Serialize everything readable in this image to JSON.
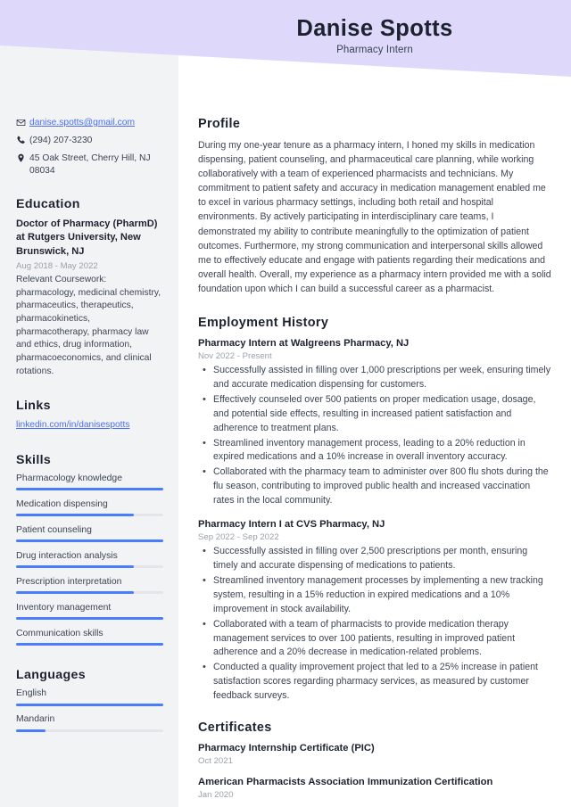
{
  "header": {
    "name": "Danise Spotts",
    "job_title": "Pharmacy Intern",
    "band_color": "#ded9fb"
  },
  "sidebar": {
    "background_color": "#f2f3f5",
    "contact": [
      {
        "icon": "envelope-icon",
        "value": "danise.spotts@gmail.com",
        "is_link": true
      },
      {
        "icon": "phone-icon",
        "value": "(294) 207-3230",
        "is_link": false
      },
      {
        "icon": "location-pin-icon",
        "value": "45 Oak Street, Cherry Hill, NJ 08034",
        "is_link": false
      }
    ],
    "education": {
      "heading": "Education",
      "degree": "Doctor of Pharmacy (PharmD) at Rutgers University, New Brunswick, NJ",
      "date": "Aug 2018 - May 2022",
      "description": "Relevant Coursework: pharmacology, medicinal chemistry, pharmaceutics, therapeutics, pharmacokinetics, pharmacotherapy, pharmacy law and ethics, drug information, pharmacoeconomics, and clinical rotations."
    },
    "links": {
      "heading": "Links",
      "items": [
        {
          "label": "linkedin.com/in/danisespotts"
        }
      ]
    },
    "skills": {
      "heading": "Skills",
      "accent_color": "#4a7dfc",
      "track_color": "#e3e5e9",
      "items": [
        {
          "label": "Pharmacology knowledge",
          "level": 100
        },
        {
          "label": "Medication dispensing",
          "level": 80
        },
        {
          "label": "Patient counseling",
          "level": 100
        },
        {
          "label": "Drug interaction analysis",
          "level": 80
        },
        {
          "label": "Prescription interpretation",
          "level": 80
        },
        {
          "label": "Inventory management",
          "level": 100
        },
        {
          "label": "Communication skills",
          "level": 100
        }
      ]
    },
    "languages": {
      "heading": "Languages",
      "items": [
        {
          "label": "English",
          "level": 100
        },
        {
          "label": "Mandarin",
          "level": 20
        }
      ]
    }
  },
  "main": {
    "profile": {
      "heading": "Profile",
      "text": "During my one-year tenure as a pharmacy intern, I honed my skills in medication dispensing, patient counseling, and pharmaceutical care planning, while working collaboratively with a team of experienced pharmacists and technicians. My commitment to patient safety and accuracy in medication management enabled me to excel in various pharmacy settings, including both retail and hospital environments. By actively participating in interdisciplinary care teams, I demonstrated my ability to contribute meaningfully to the optimization of patient outcomes. Furthermore, my strong communication and interpersonal skills allowed me to effectively educate and engage with patients regarding their medications and overall health. Overall, my experience as a pharmacy intern provided me with a solid foundation upon which I can build a successful career as a pharmacist."
    },
    "employment": {
      "heading": "Employment History",
      "jobs": [
        {
          "title": "Pharmacy Intern at Walgreens Pharmacy, NJ",
          "date": "Nov 2022 - Present",
          "bullets": [
            "Successfully assisted in filling over 1,000 prescriptions per week, ensuring timely and accurate medication dispensing for customers.",
            "Effectively counseled over 500 patients on proper medication usage, dosage, and potential side effects, resulting in increased patient satisfaction and adherence to treatment plans.",
            "Streamlined inventory management process, leading to a 20% reduction in expired medications and a 10% increase in overall inventory accuracy.",
            "Collaborated with the pharmacy team to administer over 800 flu shots during the flu season, contributing to improved public health and increased vaccination rates in the local community."
          ]
        },
        {
          "title": "Pharmacy Intern I at CVS Pharmacy, NJ",
          "date": "Sep 2022 - Sep 2022",
          "bullets": [
            "Successfully assisted in filling over 2,500 prescriptions per month, ensuring timely and accurate dispensing of medications to patients.",
            "Streamlined inventory management processes by implementing a new tracking system, resulting in a 15% reduction in expired medications and a 10% improvement in stock availability.",
            "Collaborated with a team of pharmacists to provide medication therapy management services to over 100 patients, resulting in improved patient adherence and a 20% decrease in medication-related problems.",
            "Conducted a quality improvement project that led to a 25% increase in patient satisfaction scores regarding pharmacy services, as measured by customer feedback surveys."
          ]
        }
      ]
    },
    "certificates": {
      "heading": "Certificates",
      "items": [
        {
          "title": "Pharmacy Internship Certificate (PIC)",
          "date": "Oct 2021"
        },
        {
          "title": "American Pharmacists Association Immunization Certification",
          "date": "Jan 2020"
        }
      ]
    }
  }
}
